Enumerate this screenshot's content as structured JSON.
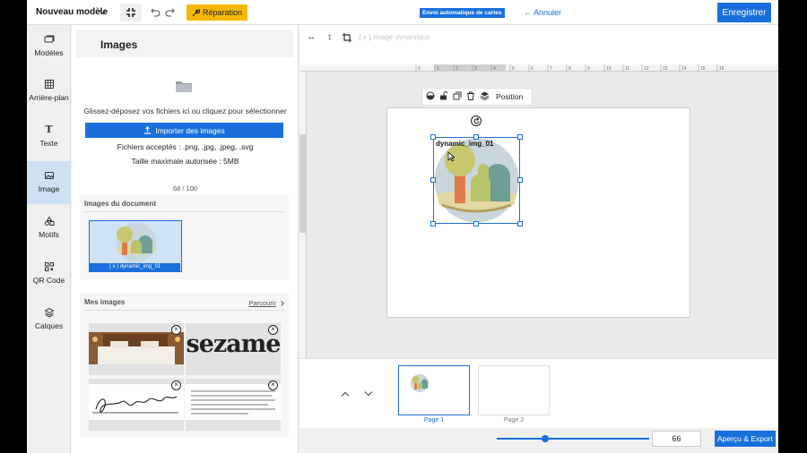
{
  "topbar": {
    "model_title": "Nouveau modèle",
    "repair_label": "Réparation",
    "auto_badge": "Envoi automatique de cartes",
    "cancel_label": "Annuler",
    "save_label": "Enregistrer"
  },
  "nav": {
    "items": [
      {
        "label": "Modèles",
        "icon": "templates-icon"
      },
      {
        "label": "Arrière-plan",
        "icon": "background-icon"
      },
      {
        "label": "Texte",
        "icon": "text-icon"
      },
      {
        "label": "Image",
        "icon": "image-icon"
      },
      {
        "label": "Motifs",
        "icon": "shapes-icon"
      },
      {
        "label": "QR Code",
        "icon": "qrcode-icon"
      },
      {
        "label": "Calques",
        "icon": "layers-icon"
      }
    ],
    "active": "Image"
  },
  "panel": {
    "title": "Images",
    "drop_text": "Glissez-déposez vos fichiers ici ou cliquez pour sélectionner",
    "import_label": "Importer des images",
    "accepted": "Fichiers acceptés : .png, .jpg, .jpeg, .svg",
    "maxsize": "Taille maximale autorisée : 5MB",
    "counter": "68 / 100",
    "doc_images_title": "Images du document",
    "doc_image_label": "{ x } dynamic_img_01",
    "my_images_title": "Mes images",
    "browse_label": "Parcourir",
    "sezame_text": "sezame",
    "signature_text": "Jean-Pierre Nadir"
  },
  "toolbar2": {
    "dynamic_label": "{ x } Image dynamique"
  },
  "ruler": {
    "ticks": [
      "0",
      "1",
      "2",
      "3",
      "4",
      "5",
      "6",
      "7",
      "8",
      "9",
      "10",
      "11",
      "12",
      "13",
      "14",
      "15",
      "16"
    ]
  },
  "canvas": {
    "element_toolbar_position": "Position",
    "selection_label": "dynamic_img_01"
  },
  "pages": {
    "items": [
      {
        "label": "Page 1"
      },
      {
        "label": "Page 2"
      }
    ],
    "active": 0
  },
  "bottombar": {
    "zoom_value": "66",
    "zoom_fraction": 0.32,
    "export_label": "Aperçu & Export"
  },
  "colors": {
    "accent": "#1a6fdc",
    "repair": "#f5b800"
  }
}
